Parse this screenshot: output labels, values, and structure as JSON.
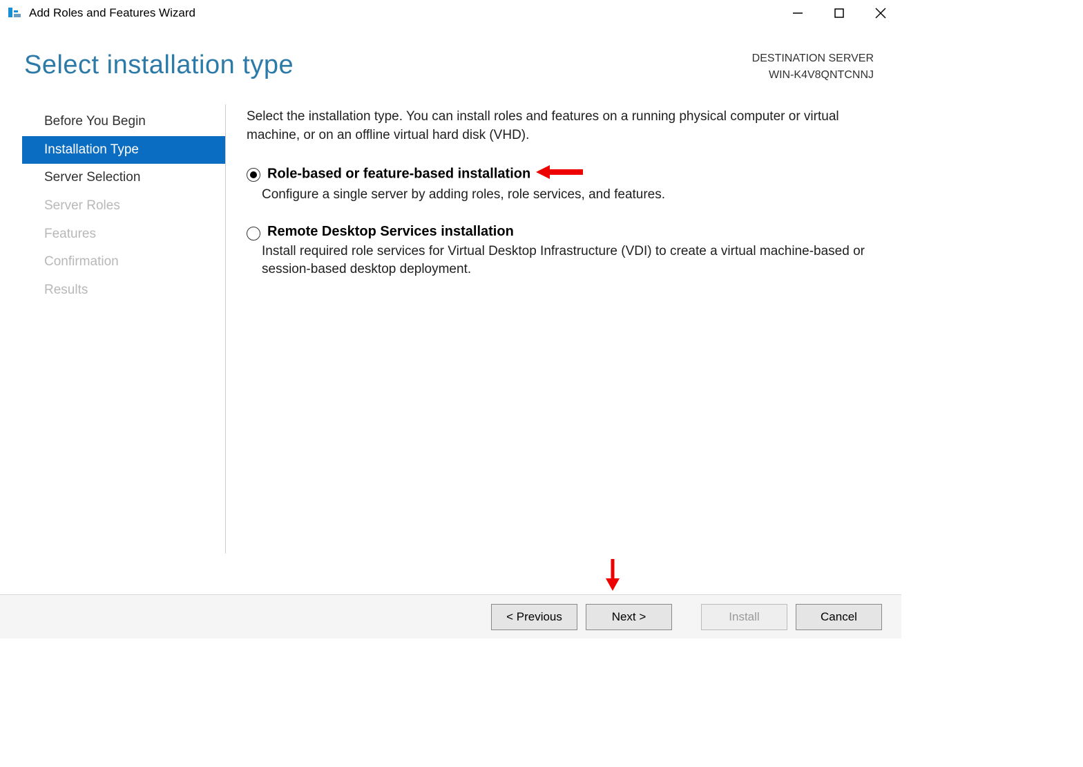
{
  "window": {
    "title": "Add Roles and Features Wizard"
  },
  "header": {
    "heading": "Select installation type",
    "destLabel": "DESTINATION SERVER",
    "destServer": "WIN-K4V8QNTCNNJ"
  },
  "sidebar": {
    "items": [
      {
        "label": "Before You Begin",
        "state": "normal"
      },
      {
        "label": "Installation Type",
        "state": "active"
      },
      {
        "label": "Server Selection",
        "state": "normal"
      },
      {
        "label": "Server Roles",
        "state": "disabled"
      },
      {
        "label": "Features",
        "state": "disabled"
      },
      {
        "label": "Confirmation",
        "state": "disabled"
      },
      {
        "label": "Results",
        "state": "disabled"
      }
    ]
  },
  "main": {
    "intro": "Select the installation type. You can install roles and features on a running physical computer or virtual machine, or on an offline virtual hard disk (VHD).",
    "options": [
      {
        "title": "Role-based or feature-based installation",
        "desc": "Configure a single server by adding roles, role services, and features.",
        "checked": true
      },
      {
        "title": "Remote Desktop Services installation",
        "desc": "Install required role services for Virtual Desktop Infrastructure (VDI) to create a virtual machine-based or session-based desktop deployment.",
        "checked": false
      }
    ]
  },
  "footer": {
    "previous": "< Previous",
    "next": "Next >",
    "install": "Install",
    "cancel": "Cancel"
  }
}
